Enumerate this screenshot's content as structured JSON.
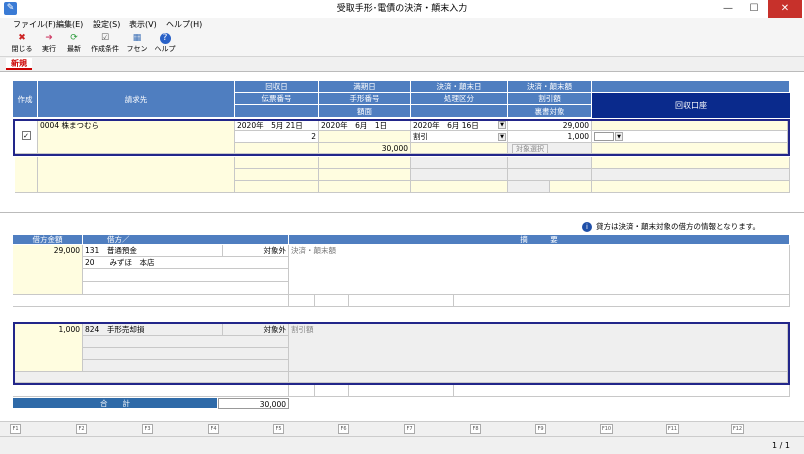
{
  "window": {
    "title": "受取手形･電債の決済・顛末入力",
    "minimize": "—",
    "maximize": "☐",
    "close": "✕"
  },
  "menu": [
    "ファイル(F)",
    "編集(E)",
    "設定(S)",
    "表示(V)",
    "ヘルプ(H)"
  ],
  "toolbar": [
    {
      "label": "閉じる",
      "icon": "close-icon",
      "glyph": "✖",
      "color": "#cc2222"
    },
    {
      "label": "実行",
      "icon": "arrow-right-icon",
      "glyph": "➜",
      "color": "#d0436b"
    },
    {
      "label": "最新",
      "icon": "refresh-icon",
      "glyph": "⟳",
      "color": "#2a9a3a"
    },
    {
      "label": "作成条件",
      "icon": "conditions-icon",
      "glyph": "☑",
      "color": "#555555"
    },
    {
      "label": "フセン",
      "icon": "sticky-note-icon",
      "glyph": "▦",
      "color": "#3b6fb6"
    },
    {
      "label": "ヘルプ",
      "icon": "help-icon",
      "glyph": "?",
      "color": "#2a62c8"
    }
  ],
  "tab": "新規",
  "grid": {
    "headers": {
      "create": "作成",
      "customer": "請求先",
      "collect_date": "回収日",
      "voucher_no": "伝票番号",
      "due_date": "満期日",
      "bill_no": "手形番号",
      "face": "額面",
      "settle_date": "決済・顛末日",
      "process": "処理区分",
      "settle_amount": "決済・顛末額",
      "discount": "割引額",
      "endorse": "裏書対象",
      "account": "回収口座"
    },
    "row1": {
      "customer": "0004 株まつむら",
      "collect_date": "2020年　5月 21日",
      "voucher_no": "2",
      "due_date": "2020年　6月　1日",
      "face": "30,000",
      "settle_date": "2020年　6月 16日",
      "process": "割引",
      "settle_amount": "29,000",
      "discount": "1,000",
      "target_button": "対象選択"
    }
  },
  "notice": "貸方は決済・顛末対象の借方の情報となります。",
  "journal": {
    "headers": {
      "debit_amount": "借方金額",
      "debit": "借方／",
      "summary": "摘　　　要"
    },
    "entry1": {
      "amount": "29,000",
      "code": "131",
      "account": "普通預金",
      "sub_code": "20",
      "sub_account": "みずほ　本店",
      "tax": "対象外",
      "summary": "決済・顛末額"
    },
    "entry2": {
      "amount": "1,000",
      "code": "824",
      "account": "手形売却損",
      "tax": "対象外",
      "summary": "割引額"
    },
    "total_label": "合　　計",
    "total": "30,000"
  },
  "fkeys": [
    "F1",
    "F2",
    "F3",
    "F4",
    "F5",
    "F6",
    "F7",
    "F8",
    "F9",
    "F10",
    "F11",
    "F12"
  ],
  "page": "1 / 1"
}
